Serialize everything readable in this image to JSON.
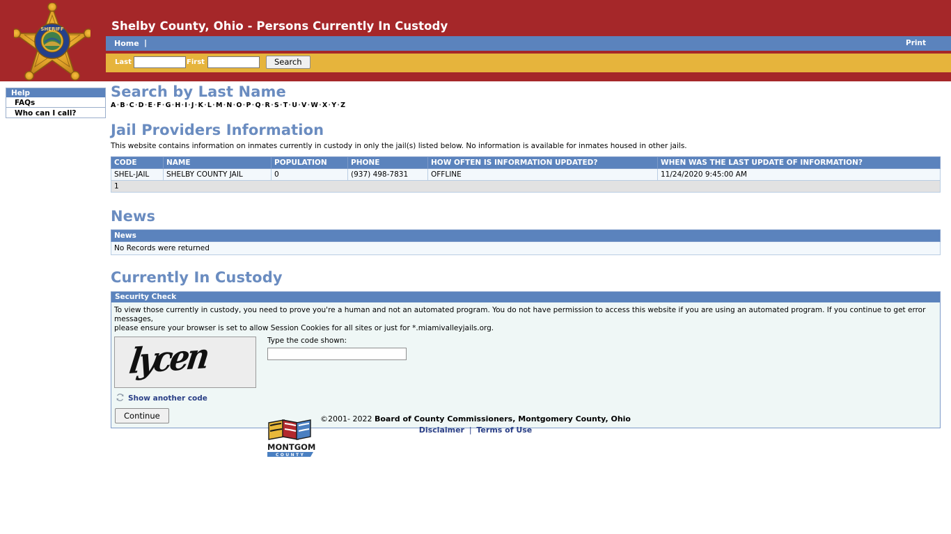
{
  "header": {
    "title": "Shelby County, Ohio - Persons Currently In Custody",
    "badge_icon": "sheriff-star-badge-icon",
    "nav": {
      "home_label": "Home",
      "divider": "|",
      "print_label": "Print"
    },
    "search": {
      "last_label": "Last",
      "last_value": "",
      "first_label": "First",
      "first_value": "",
      "button_label": "Search"
    }
  },
  "sidebar": {
    "head_label": "Help",
    "items": [
      {
        "label": "FAQs"
      },
      {
        "label": "Who can I call?"
      }
    ]
  },
  "search_by_last_name": {
    "heading": "Search by Last Name",
    "letters": [
      "A",
      "B",
      "C",
      "D",
      "E",
      "F",
      "G",
      "H",
      "I",
      "J",
      "K",
      "L",
      "M",
      "N",
      "O",
      "P",
      "Q",
      "R",
      "S",
      "T",
      "U",
      "V",
      "W",
      "X",
      "Y",
      "Z"
    ],
    "separator": "·"
  },
  "jail_providers": {
    "heading": "Jail Providers Information",
    "blurb": "This website contains information on inmates currently in custody in only the jail(s) listed below. No information is available for inmates housed in other jails.",
    "columns": [
      "CODE",
      "NAME",
      "POPULATION",
      "PHONE",
      "HOW OFTEN IS INFORMATION UPDATED?",
      "WHEN WAS THE LAST UPDATE OF INFORMATION?"
    ],
    "rows": [
      {
        "code": "SHEL-JAIL",
        "name": "SHELBY COUNTY JAIL",
        "population": "0",
        "phone": "(937) 498-7831",
        "updated": "OFFLINE",
        "last_update": "11/24/2020 9:45:00 AM"
      }
    ],
    "pager": "1"
  },
  "news": {
    "heading": "News",
    "column": "News",
    "empty_message": "No Records were returned"
  },
  "custody": {
    "heading": "Currently In Custody",
    "panel_title": "Security Check",
    "body_line1": "To view those currently in custody, you need to prove you're a human and not an automated program. You do not have permission to access this website if you are using an automated program. If you continue to get error messages,",
    "body_line2": "please ensure your browser is set to allow Session Cookies for all sites or just for *.miamivalleyjails.org.",
    "captcha_code": "lycen",
    "code_label": "Type the code shown:",
    "code_value": "",
    "refresh_icon": "refresh-icon",
    "refresh_label": "Show another code",
    "continue_label": "Continue"
  },
  "footer": {
    "logo_icon": "montgomery-county-flags-logo",
    "logo_word_main": "MONTGOMERY",
    "logo_word_sub": "COUNTY",
    "copyright_prefix": "©2001- 2022",
    "copyright_owner": "Board of County Commissioners, Montgomery County, Ohio",
    "disclaimer_label": "Disclaimer",
    "separator": "|",
    "terms_label": "Terms of Use"
  },
  "colors": {
    "header_red": "#a52729",
    "nav_blue": "#5b83bd",
    "search_gold": "#e6b43c",
    "heading_blue": "#6a8cc0",
    "panel_mint": "#eff7f6",
    "link_navy": "#2a3f86"
  }
}
